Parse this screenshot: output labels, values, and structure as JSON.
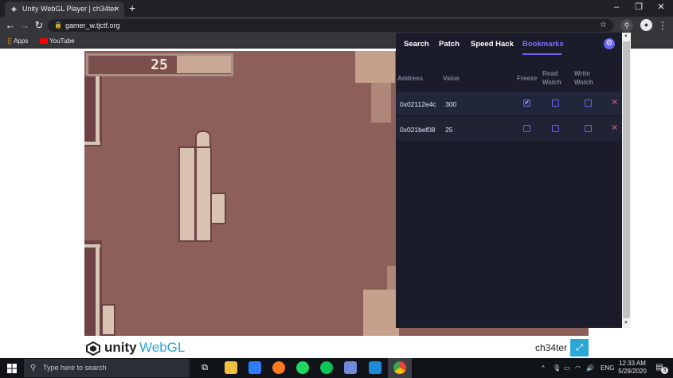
{
  "browser": {
    "tab_title": "Unity WebGL Player | ch34ter",
    "tab_close": "×",
    "new_tab": "+",
    "url": "gamer_w.tjctf.org",
    "window_controls": [
      "–",
      "❐",
      "✕"
    ],
    "bookmarks": [
      {
        "label": "Apps",
        "icon": "apps-grid-icon"
      },
      {
        "label": "YouTube",
        "icon": "youtube-icon"
      }
    ]
  },
  "game": {
    "hud_value": "25",
    "footer": {
      "brand_unity": "unity",
      "brand_webgl": "WebGL",
      "game_name": "ch34ter",
      "fullscreen_icon": "⤢"
    }
  },
  "cheat_panel": {
    "tabs": [
      {
        "label": "Search"
      },
      {
        "label": "Patch"
      },
      {
        "label": "Speed Hack"
      },
      {
        "label": "Bookmarks",
        "active": true
      }
    ],
    "settings_icon": "⚙",
    "columns": {
      "address": "Address",
      "value": "Value",
      "freeze": "Freeze",
      "read_watch_1": "Read",
      "read_watch_2": "Watch",
      "write_watch_1": "Write",
      "write_watch_2": "Watch"
    },
    "rows": [
      {
        "address": "0x02112e4c",
        "value": "300",
        "freeze": true,
        "read_watch": false,
        "write_watch": false,
        "delete": "✕"
      },
      {
        "address": "0x021bef08",
        "value": "25",
        "freeze": false,
        "read_watch": false,
        "write_watch": false,
        "delete": "✕"
      }
    ],
    "accent_color": "#6b62f0"
  },
  "taskbar": {
    "search_placeholder": "Type here to search",
    "apps": [
      "task-view-icon",
      "file-explorer-icon",
      "chat-app-icon",
      "firefox-icon",
      "spotify-icon",
      "line-icon",
      "discord-icon",
      "vscode-icon",
      "chrome-icon"
    ],
    "language": "ENG",
    "time": "12:33 AM",
    "date": "5/29/2020",
    "notification_count": "3"
  }
}
